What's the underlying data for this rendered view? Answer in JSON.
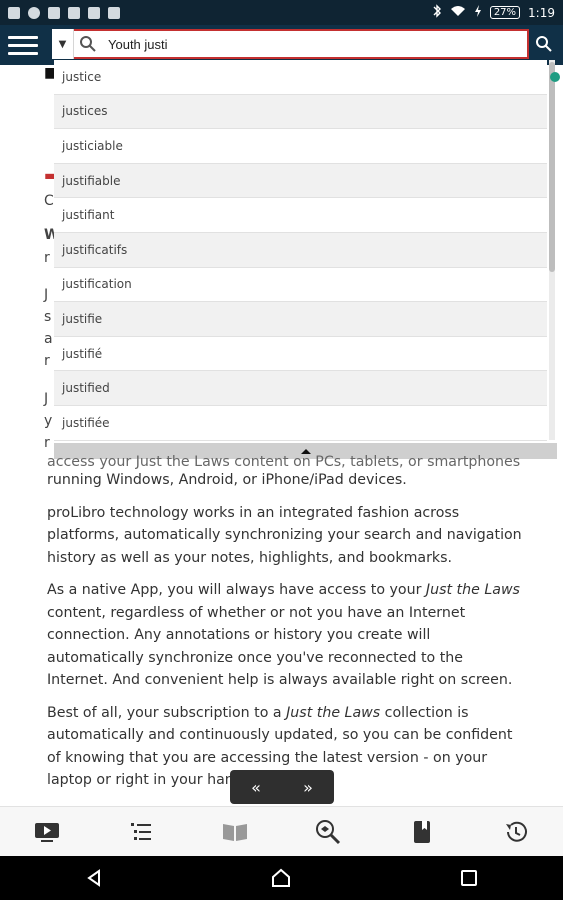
{
  "status": {
    "battery": "27%",
    "time": "1:19"
  },
  "search": {
    "value": "Youth justi"
  },
  "suggestions": [
    "justice",
    "justices",
    "justiciable",
    "justifiable",
    "justifiant",
    "justificatifs",
    "justification",
    "justifie",
    "justifié",
    "justified",
    "justifiée"
  ],
  "content": {
    "p1_line1": "access your Just the Laws content on PCs, tablets, or smartphones",
    "p1_line2": "running Windows, Android, or iPhone/iPad devices.",
    "p2": "proLibro technology works in an integrated fashion across platforms, automatically synchronizing your search and navigation history as well as your notes, highlights, and bookmarks.",
    "p3_before": "As a native App, you will always have access to your ",
    "p3_em": "Just the Laws",
    "p3_after": " content, regardless of whether or not you have an Internet connection. Any annotations or history you create will automatically synchronize once you've reconnected to the Internet. And convenient help is always available right on screen.",
    "p4_before": "Best of all, your subscription to a ",
    "p4_em": "Just the Laws",
    "p4_after": " collection is automatically and continuously updated, so you can be confident of knowing that you are accessing the latest version - on your laptop or right in your hand."
  },
  "left_fragments": [
    "C",
    "W",
    "r",
    "J",
    "s",
    "a",
    "r",
    "J",
    "y",
    "r"
  ],
  "pager": {
    "prev": "«",
    "next": "»"
  },
  "toolbar_icons": [
    "video-icon",
    "list-icon",
    "book-open-icon",
    "search-zoom-icon",
    "bookmark-book-icon",
    "history-icon"
  ],
  "navbar_icons": [
    "back-icon",
    "home-icon",
    "recents-icon"
  ],
  "colors": {
    "accent": "#103047",
    "status_bg": "#0f2433",
    "search_border": "#c43030",
    "dot": "#1e9c82"
  }
}
